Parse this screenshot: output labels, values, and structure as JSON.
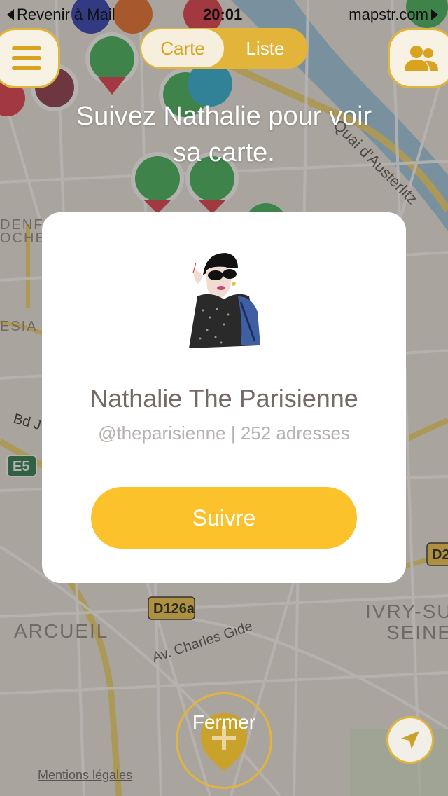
{
  "status_bar": {
    "back_label": "Revenir à Mail",
    "time": "20:01",
    "site": "mapstr.com"
  },
  "top_bar": {
    "tabs": [
      {
        "label": "Carte",
        "active": true
      },
      {
        "label": "Liste",
        "active": false
      }
    ]
  },
  "map_labels": {
    "street_1": "Quai d'Austerlitz",
    "road_badge": "E5",
    "road_badge_2": "D126a",
    "road_badge_3": "D2",
    "street_2": "Av. Charles Gide",
    "street_3": "Bd J",
    "place_1": "ARCUEIL",
    "place_2": "IVRY-SU",
    "place_3": "SEINE",
    "place_4": "ESIA",
    "place_5": "DENFE",
    "place_6": "OCHER"
  },
  "headline": "Suivez Nathalie pour voir\nsa carte.",
  "profile": {
    "name": "Nathalie The Parisienne",
    "handle": "@theparisienne",
    "addresses": "252 adresses",
    "separator": "|",
    "follow_label": "Suivre"
  },
  "bottom": {
    "close_label": "Fermer",
    "legal_label": "Mentions légales"
  },
  "colors": {
    "accent": "#fbc22b",
    "accent_dark": "#d9a21f",
    "card_bg": "#ffffff",
    "name_text": "#776a66",
    "meta_text": "#b7b2af"
  }
}
